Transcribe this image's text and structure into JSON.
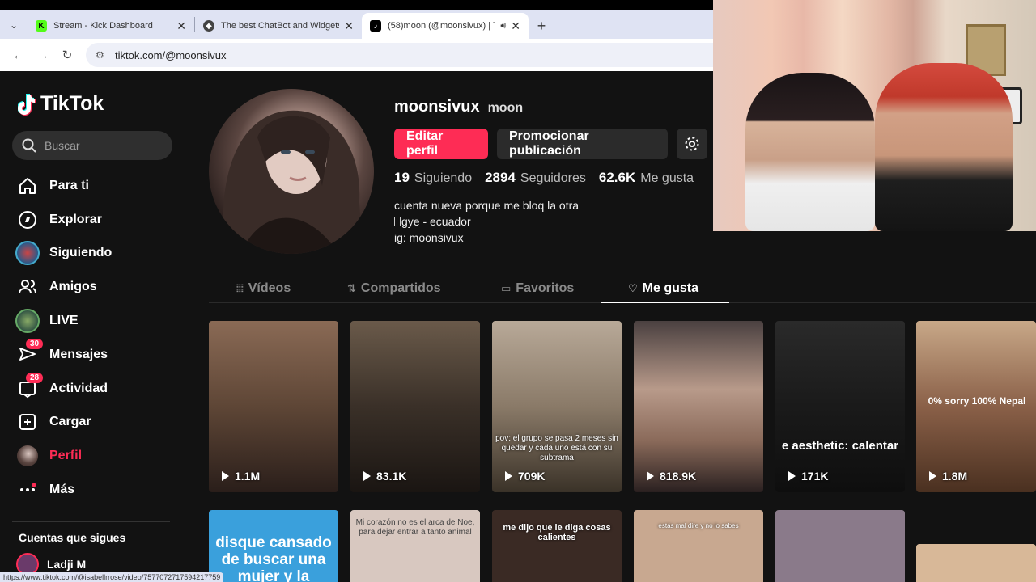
{
  "browser": {
    "tabs": [
      {
        "title": "Stream - Kick Dashboard",
        "favicon": "K",
        "color": "#53fc18",
        "active": false
      },
      {
        "title": "The best ChatBot and Widgets f",
        "favicon": "◆",
        "color": "#333333",
        "active": false
      },
      {
        "title": "(58)moon (@moonsivux) | T",
        "favicon": "♪",
        "color": "#000000",
        "active": true
      }
    ],
    "url": "tiktok.com/@moonsivux",
    "status_url": "https://www.tiktok.com/@isabellrrose/video/7577072717594217759"
  },
  "sidebar": {
    "logo": "TikTok",
    "search_placeholder": "Buscar",
    "items": [
      {
        "label": "Para ti",
        "icon": "home-icon"
      },
      {
        "label": "Explorar",
        "icon": "compass-icon"
      },
      {
        "label": "Siguiendo",
        "icon": "following-avatar-icon"
      },
      {
        "label": "Amigos",
        "icon": "friends-icon"
      },
      {
        "label": "LIVE",
        "icon": "live-avatar-icon"
      },
      {
        "label": "Mensajes",
        "icon": "paper-plane-icon",
        "badge": "30"
      },
      {
        "label": "Actividad",
        "icon": "inbox-icon",
        "badge": "28"
      },
      {
        "label": "Cargar",
        "icon": "plus-square-icon"
      },
      {
        "label": "Perfil",
        "icon": "profile-avatar-icon"
      },
      {
        "label": "Más",
        "icon": "more-dots-icon"
      }
    ],
    "following_title": "Cuentas que sigues",
    "following": [
      {
        "name": "Ladji M"
      }
    ]
  },
  "profile": {
    "username": "moonsivux",
    "nickname": "moon",
    "edit_button": "Editar perfil",
    "promote_button": "Promocionar publicación",
    "stats": {
      "following": "19",
      "following_label": "Siguiendo",
      "followers": "2894",
      "followers_label": "Seguidores",
      "likes": "62.6K",
      "likes_label": "Me gusta"
    },
    "bio": [
      "cuenta nueva porque me bloq la otra",
      "gye - ecuador",
      "ig: moonsivux"
    ]
  },
  "tabs": [
    {
      "label": "Vídeos",
      "icon": "grid-icon"
    },
    {
      "label": "Compartidos",
      "icon": "repost-icon"
    },
    {
      "label": "Favoritos",
      "icon": "bookmark-icon"
    },
    {
      "label": "Me gusta",
      "icon": "heart-icon"
    }
  ],
  "videos": [
    {
      "views": "1.1M",
      "caption": "",
      "bg": "linear-gradient(180deg,#8a6a55,#5e4636 50%,#2a1e1a)"
    },
    {
      "views": "83.1K",
      "caption": "",
      "bg": "linear-gradient(180deg,#6a5a4a,#3a3028 50%,#1a1512)"
    },
    {
      "views": "709K",
      "caption": "pov: el grupo se pasa 2 meses sin quedar y cada uno está con su subtrama",
      "bg": "linear-gradient(180deg,#b8a998,#8a7a68 50%,#3a3228)"
    },
    {
      "views": "818.9K",
      "caption": "",
      "bg": "linear-gradient(180deg,#4a4040,#b89a8a 40%,#8a6a5a 70%,#2a2020)"
    },
    {
      "views": "171K",
      "caption": "e aesthetic: calentar",
      "bg": "linear-gradient(180deg,#2a2a2a,#1a1a1a 50%,#0e0e0e)"
    },
    {
      "views": "1.8M",
      "caption": "0% sorry 100% Nepal",
      "bg": "linear-gradient(180deg,#c8a888,#8a6048 50%,#4a3020)"
    }
  ],
  "videos_row2": [
    {
      "caption": "disque cansado de buscar una mujer y la",
      "bg": "#3aa0dc"
    },
    {
      "caption": "Mi corazón no es el arca de Noe, para dejar entrar a tanto animal",
      "bg": "#d8c8c0"
    },
    {
      "caption": "me dijo que le diga cosas calientes",
      "bg": "#3a2a24"
    },
    {
      "caption": "estás mal dire y no lo sabes",
      "bg": "#c8a890"
    },
    {
      "caption": "",
      "bg": "#8a7a8a"
    },
    {
      "caption": "",
      "bg": "#d8b898"
    }
  ]
}
